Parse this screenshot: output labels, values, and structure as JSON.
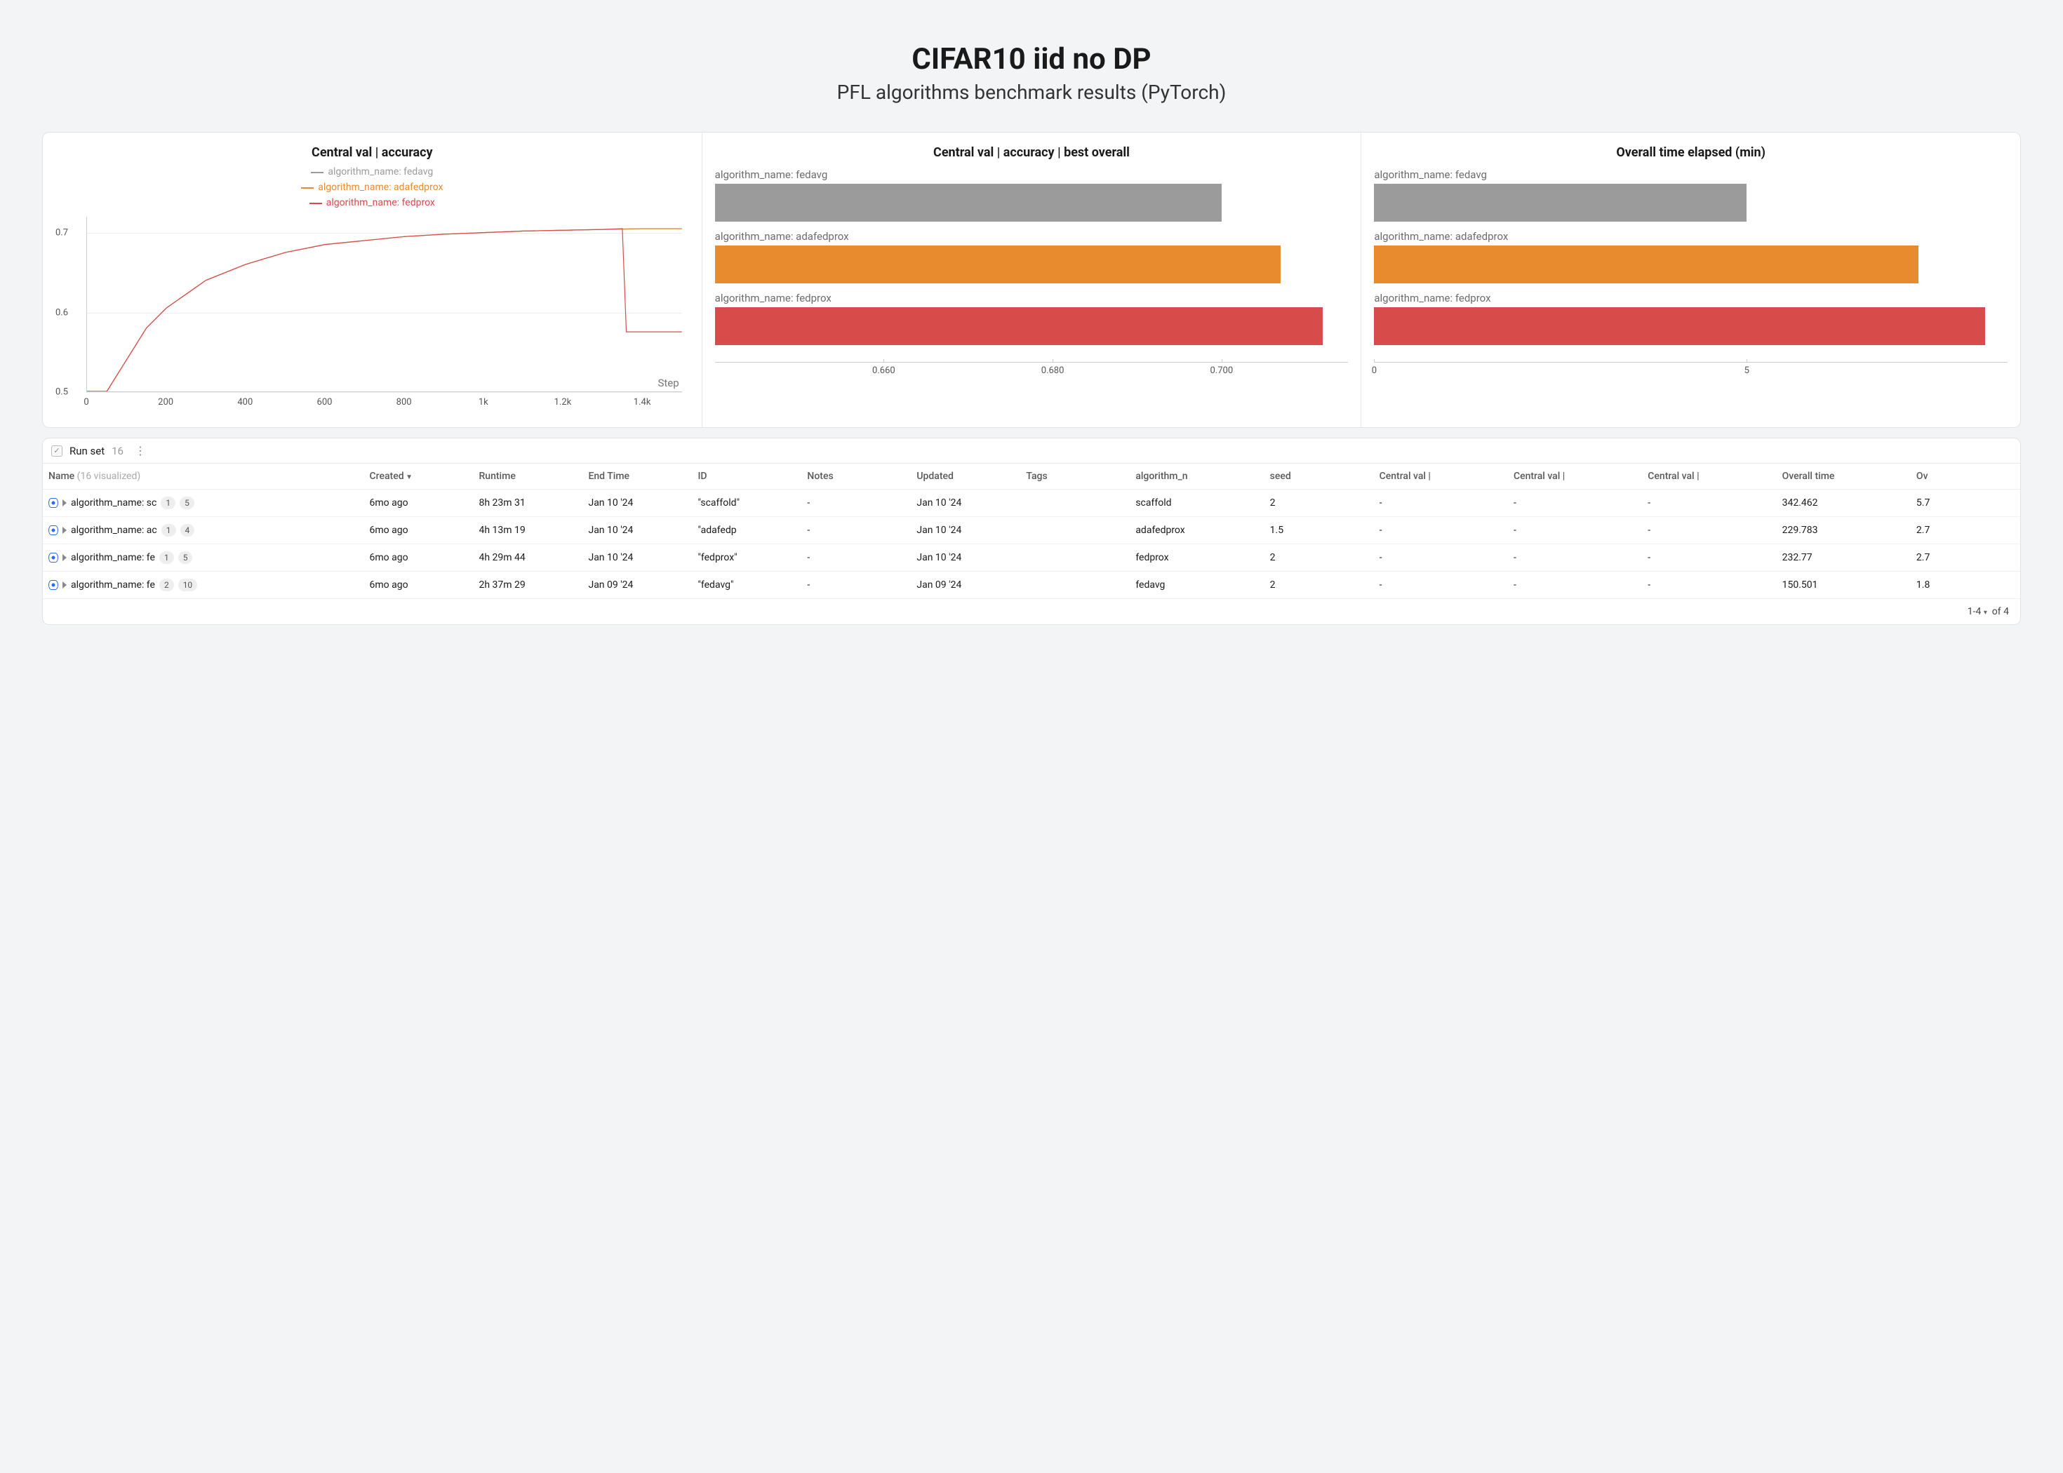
{
  "header": {
    "title": "CIFAR10 iid no DP",
    "subtitle": "PFL algorithms benchmark results (PyTorch)"
  },
  "colors": {
    "fedavg": "#9b9b9b",
    "adafedprox": "#e88b2f",
    "fedprox": "#d84b4b"
  },
  "panel1": {
    "title": "Central val | accuracy",
    "legend": [
      "algorithm_name: fedavg",
      "algorithm_name: adafedprox",
      "algorithm_name: fedprox"
    ],
    "xlabel": "Step"
  },
  "panel2": {
    "title": "Central val | accuracy | best overall",
    "labels": {
      "fedavg": "algorithm_name: fedavg",
      "adafedprox": "algorithm_name: adafedprox",
      "fedprox": "algorithm_name: fedprox"
    }
  },
  "panel3": {
    "title": "Overall time elapsed (min)",
    "labels": {
      "fedavg": "algorithm_name: fedavg",
      "adafedprox": "algorithm_name: adafedprox",
      "fedprox": "algorithm_name: fedprox"
    }
  },
  "chart_data": [
    {
      "type": "line",
      "title": "Central val | accuracy",
      "xlabel": "Step",
      "ylabel": "",
      "xlim": [
        0,
        1500
      ],
      "ylim": [
        0.5,
        0.72
      ],
      "xticks": [
        0,
        200,
        400,
        600,
        800,
        "1k",
        "1.2k",
        "1.4k"
      ],
      "yticks": [
        0.5,
        0.6,
        0.7
      ],
      "series": [
        {
          "name": "algorithm_name: fedavg",
          "color": "#9b9b9b",
          "x": [
            0,
            50,
            100,
            150,
            200,
            300,
            400,
            500,
            600,
            700,
            800,
            900,
            1000,
            1100,
            1200,
            1300,
            1400,
            1500
          ],
          "y": [
            0.12,
            0.45,
            0.54,
            0.58,
            0.605,
            0.64,
            0.66,
            0.675,
            0.685,
            0.69,
            0.695,
            0.698,
            0.7,
            0.702,
            0.703,
            0.704,
            0.705,
            0.705
          ]
        },
        {
          "name": "algorithm_name: adafedprox",
          "color": "#e88b2f",
          "x": [
            0,
            50,
            100,
            150,
            200,
            300,
            400,
            500,
            600,
            700,
            800,
            900,
            1000,
            1100,
            1200,
            1300,
            1400,
            1500
          ],
          "y": [
            0.12,
            0.45,
            0.54,
            0.58,
            0.605,
            0.64,
            0.66,
            0.675,
            0.685,
            0.69,
            0.695,
            0.698,
            0.7,
            0.702,
            0.703,
            0.704,
            0.705,
            0.705
          ]
        },
        {
          "name": "algorithm_name: fedprox",
          "color": "#d84b4b",
          "x": [
            0,
            50,
            100,
            150,
            200,
            300,
            400,
            500,
            600,
            700,
            800,
            900,
            1000,
            1100,
            1200,
            1300,
            1350,
            1360,
            1500
          ],
          "y": [
            0.12,
            0.45,
            0.54,
            0.58,
            0.605,
            0.64,
            0.66,
            0.675,
            0.685,
            0.69,
            0.695,
            0.698,
            0.7,
            0.702,
            0.703,
            0.704,
            0.705,
            0.575,
            0.575
          ]
        }
      ]
    },
    {
      "type": "bar",
      "title": "Central val | accuracy | best overall",
      "orientation": "horizontal",
      "xlim": [
        0.64,
        0.715
      ],
      "xticks": [
        0.66,
        0.68,
        0.7
      ],
      "categories": [
        "algorithm_name: fedavg",
        "algorithm_name: adafedprox",
        "algorithm_name: fedprox"
      ],
      "values": [
        0.7,
        0.707,
        0.712
      ],
      "colors": [
        "#9b9b9b",
        "#e88b2f",
        "#d84b4b"
      ]
    },
    {
      "type": "bar",
      "title": "Overall time elapsed (min)",
      "orientation": "horizontal",
      "xlim": [
        0,
        8.5
      ],
      "xticks": [
        0,
        5
      ],
      "categories": [
        "algorithm_name: fedavg",
        "algorithm_name: adafedprox",
        "algorithm_name: fedprox"
      ],
      "values": [
        5.0,
        7.3,
        8.2
      ],
      "colors": [
        "#9b9b9b",
        "#e88b2f",
        "#d84b4b"
      ]
    }
  ],
  "runset": {
    "checkbox_glyph": "✓",
    "label": "Run set",
    "count": "16",
    "menu_glyph": "⋮"
  },
  "table": {
    "name_header": "Name",
    "name_header_sub": "(16 visualized)",
    "columns": [
      "Created",
      "Runtime",
      "End Time",
      "ID",
      "Notes",
      "Updated",
      "Tags",
      "algorithm_n",
      "seed",
      "Central val |",
      "Central val |",
      "Central val |",
      "Overall time",
      "Ov"
    ],
    "sort_glyph": "▼",
    "rows": [
      {
        "name": "algorithm_name: sc",
        "b1": "1",
        "b2": "5",
        "created": "6mo ago",
        "runtime": "8h 23m 31",
        "end": "Jan 10 '24",
        "id": "\"scaffold\"",
        "notes": "-",
        "updated": "Jan 10 '24",
        "tags": "",
        "alg": "scaffold",
        "seed": "2",
        "cv1": "-",
        "cv2": "-",
        "cv3": "-",
        "ot": "342.462",
        "ov": "5.7"
      },
      {
        "name": "algorithm_name: ac",
        "b1": "1",
        "b2": "4",
        "created": "6mo ago",
        "runtime": "4h 13m 19",
        "end": "Jan 10 '24",
        "id": "\"adafedp",
        "notes": "-",
        "updated": "Jan 10 '24",
        "tags": "",
        "alg": "adafedprox",
        "seed": "1.5",
        "cv1": "-",
        "cv2": "-",
        "cv3": "-",
        "ot": "229.783",
        "ov": "2.7"
      },
      {
        "name": "algorithm_name: fe",
        "b1": "1",
        "b2": "5",
        "created": "6mo ago",
        "runtime": "4h 29m 44",
        "end": "Jan 10 '24",
        "id": "\"fedprox\"",
        "notes": "-",
        "updated": "Jan 10 '24",
        "tags": "",
        "alg": "fedprox",
        "seed": "2",
        "cv1": "-",
        "cv2": "-",
        "cv3": "-",
        "ot": "232.77",
        "ov": "2.7"
      },
      {
        "name": "algorithm_name: fe",
        "b1": "2",
        "b2": "10",
        "created": "6mo ago",
        "runtime": "2h 37m 29",
        "end": "Jan 09 '24",
        "id": "\"fedavg\"",
        "notes": "-",
        "updated": "Jan 09 '24",
        "tags": "",
        "alg": "fedavg",
        "seed": "2",
        "cv1": "-",
        "cv2": "-",
        "cv3": "-",
        "ot": "150.501",
        "ov": "1.8"
      }
    ]
  },
  "pager": {
    "range": "1-4",
    "of": "of 4",
    "carat": "▾"
  }
}
